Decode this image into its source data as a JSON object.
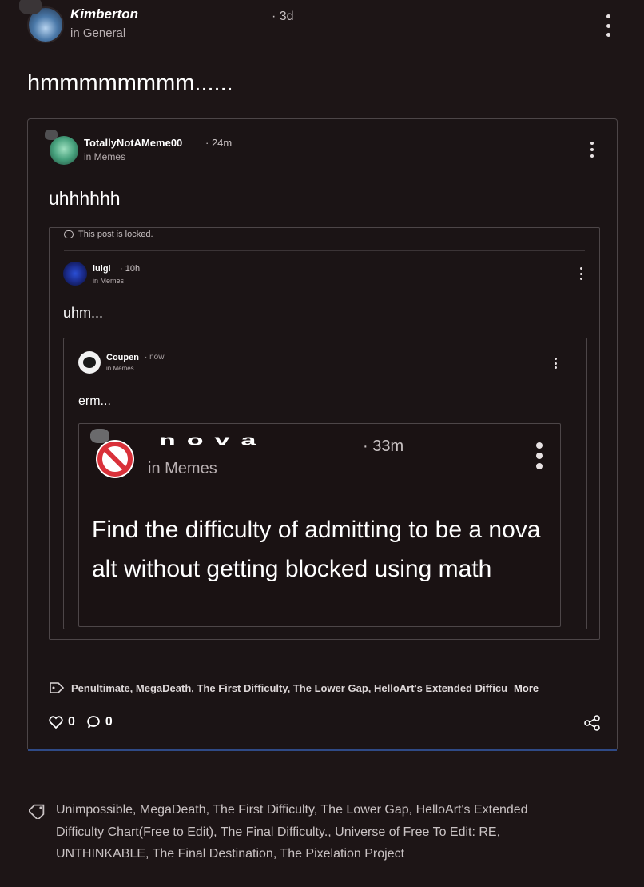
{
  "post": {
    "author": "Kimberton",
    "community": "in General",
    "time": "· 3d",
    "title": "hmmmmmmmm......",
    "tags": "Unimpossible, MegaDeath, The First Difficulty, The Lower Gap, HelloArt's Extended Difficulty Chart(Free to Edit), The Final Difficulty., Universe of Free To Edit: RE, UNTHINKABLE, The Final Destination, The Pixelation Project"
  },
  "embed1": {
    "author": "TotallyNotAMeme00",
    "time": "· 24m",
    "community": "in Memes",
    "text": "uhhhhhh",
    "locked_notice": "This post is locked.",
    "tags": "Penultimate, MegaDeath, The First Difficulty, The Lower Gap, HelloArt's Extended Difficu",
    "tags_more": "More",
    "likes": "0",
    "comments": "0"
  },
  "embed2": {
    "author": "luigi",
    "time": "· 10h",
    "community": "in Memes",
    "text": "uhm..."
  },
  "embed3": {
    "author": "Coupen",
    "time": "· now",
    "community": "in Memes",
    "text": "erm..."
  },
  "embed4": {
    "author": "nova",
    "time": "· 33m",
    "community": "in Memes",
    "text": "Find the difficulty of admitting to be a nova alt without getting blocked using math"
  },
  "icons": {
    "tag": "tag-icon",
    "heart": "heart-icon",
    "comment": "comment-icon",
    "share": "share-icon",
    "more": "more-vertical-icon",
    "locked": "speech-bubble-icon",
    "no_sign": "prohibited-icon"
  }
}
